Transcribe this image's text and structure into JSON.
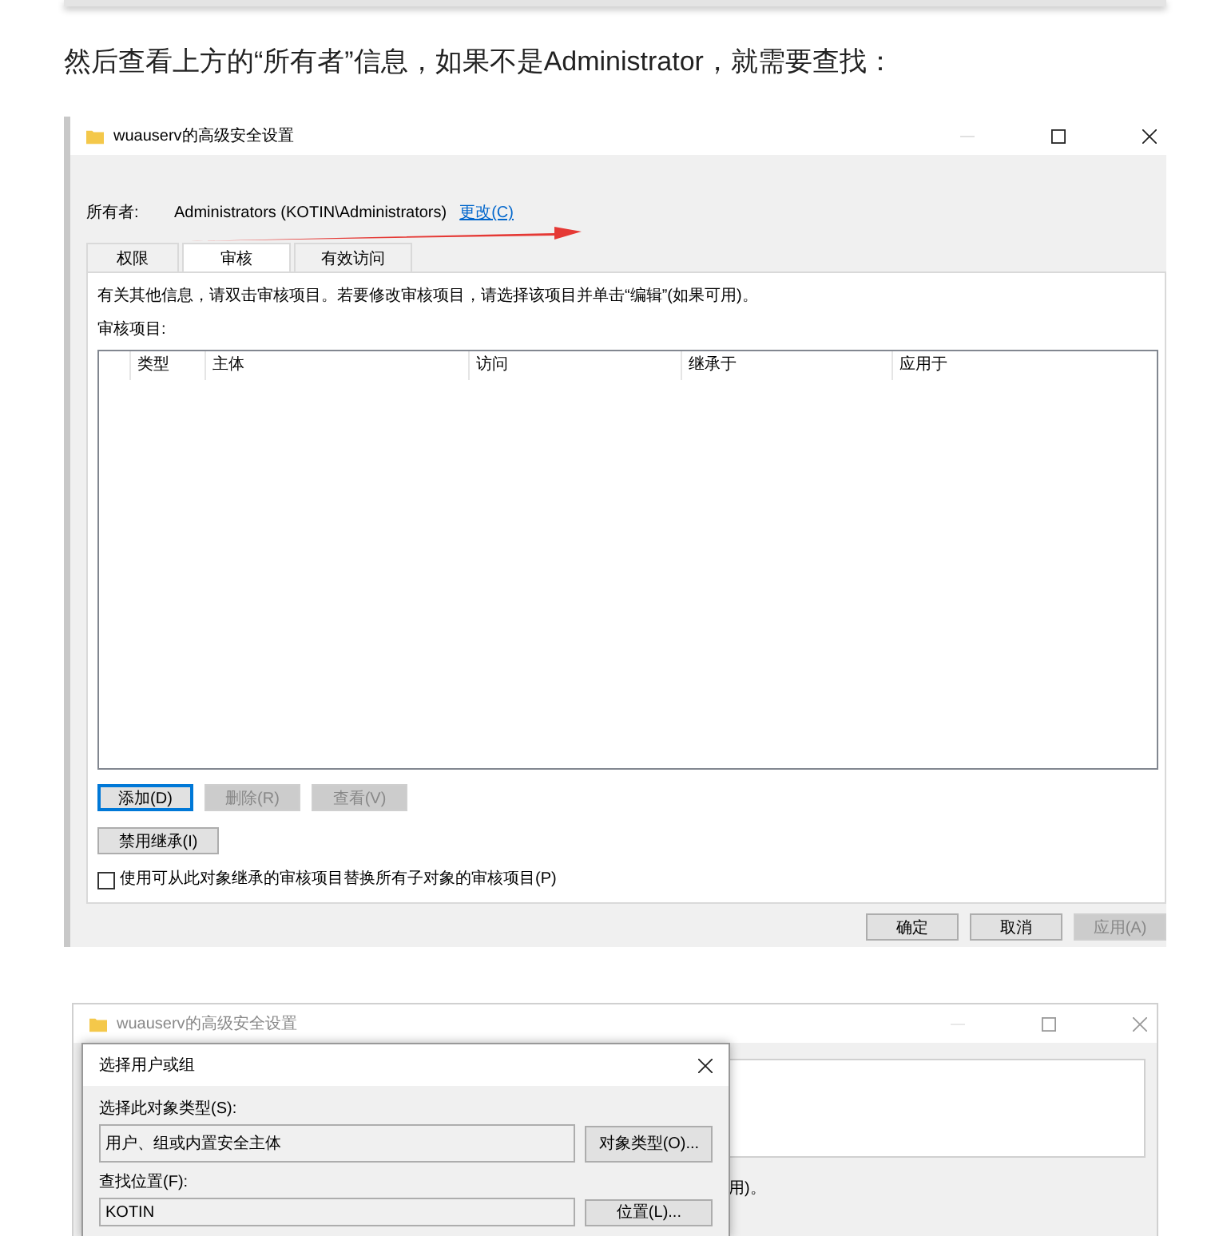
{
  "article": {
    "paragraph": "然后查看上方的“所有者”信息，如果不是Administrator，就需要查找："
  },
  "screenshots": [
    {
      "kind": "advanced_security",
      "title": "wuauserv的高级安全设置",
      "owner_label": "所有者:",
      "owner_value": "Administrators (KOTIN\\Administrators)",
      "change_link": "更改(C)",
      "tabs": [
        {
          "label": "权限",
          "selected": false
        },
        {
          "label": "审核",
          "selected": true
        },
        {
          "label": "有效访问",
          "selected": false
        }
      ],
      "info": "有关其他信息，请双击审核项目。若要修改审核项目，请选择该项目并单击“编辑”(如果可用)。",
      "list_label": "审核项目:",
      "columns": [
        "类型",
        "主体",
        "访问",
        "继承于",
        "应用于"
      ],
      "buttons": [
        {
          "label": "添加(D)",
          "disabled": false,
          "focused": true
        },
        {
          "label": "删除(R)",
          "disabled": true,
          "focused": false
        },
        {
          "label": "查看(V)",
          "disabled": true,
          "focused": false
        }
      ],
      "inherit_button": "禁用继承(I)",
      "checkbox": {
        "label": "使用可从此对象继承的审核项目替换所有子对象的审核项目(P)",
        "checked": false
      },
      "footer_buttons": [
        {
          "label": "确定",
          "disabled": false
        },
        {
          "label": "取消",
          "disabled": false
        },
        {
          "label": "应用(A)",
          "disabled": true
        }
      ]
    },
    {
      "kind": "select_dialog",
      "title": "wuauserv的高级安全设置",
      "back_text": "用)。",
      "dialog": {
        "title": "选择用户或组",
        "fields": [
          {
            "label": "选择此对象类型(S):",
            "value": "用户、组或内置安全主体",
            "button": "对象类型(O)..."
          },
          {
            "label": "查找位置(F):",
            "value": "KOTIN",
            "button": "位置(L)..."
          }
        ]
      }
    }
  ]
}
